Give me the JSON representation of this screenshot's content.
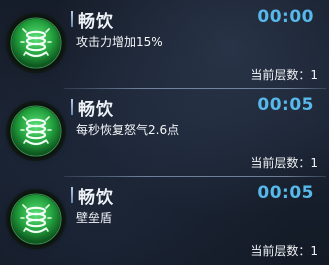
{
  "buffs": [
    {
      "icon": "spring-coil-icon",
      "name": "畅饮",
      "timer": "00:00",
      "description": "攻击力增加15%",
      "stack_label": "当前层数：",
      "stack_count": "1"
    },
    {
      "icon": "spring-coil-icon",
      "name": "畅饮",
      "timer": "00:05",
      "description": "每秒恢复怒气2.6点",
      "stack_label": "当前层数：",
      "stack_count": "1"
    },
    {
      "icon": "spring-coil-icon",
      "name": "畅饮",
      "timer": "00:05",
      "description": "壁垒盾",
      "stack_label": "当前层数：",
      "stack_count": "1"
    }
  ],
  "colors": {
    "timer": "#57b8ea",
    "icon_green": "#2fb84a",
    "background": "#1a2231"
  }
}
